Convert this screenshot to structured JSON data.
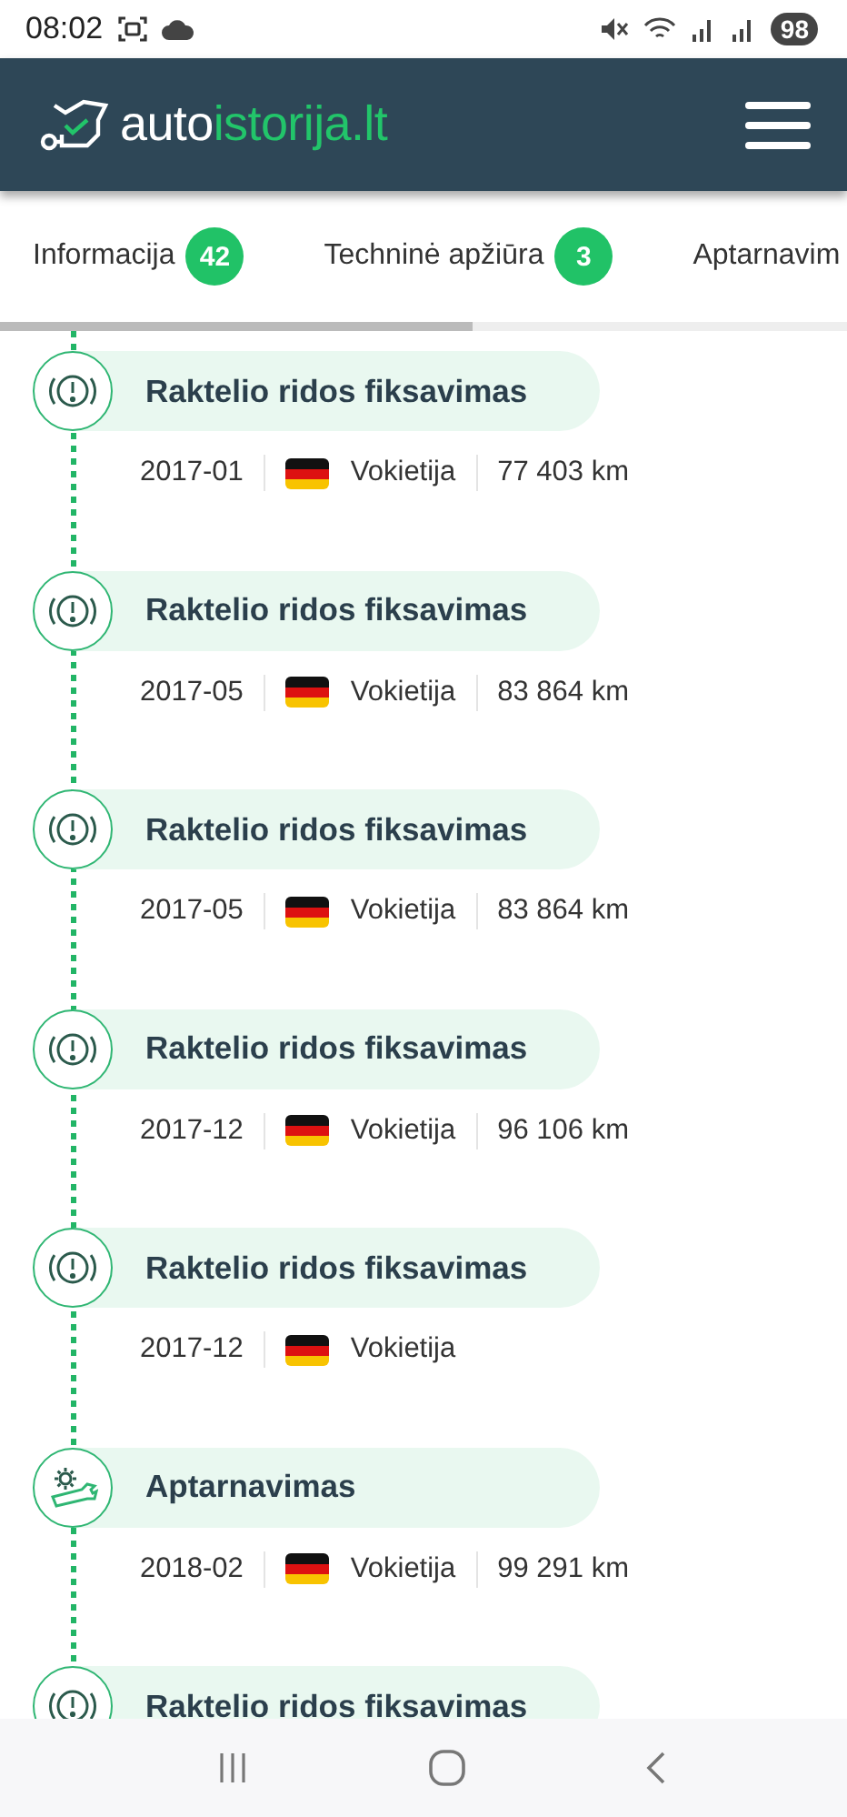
{
  "status_bar": {
    "time": "08:02",
    "battery": "98"
  },
  "header": {
    "logo": {
      "part_1": "auto",
      "part_2": "istorija.lt"
    }
  },
  "tabs": [
    {
      "label": "Informacija",
      "count": "42"
    },
    {
      "label": "Techninė apžiūra",
      "count": "3"
    },
    {
      "label": "Aptarnavim"
    }
  ],
  "events": [
    {
      "kind": "warning",
      "title": "Raktelio ridos fiksavimas",
      "date": "2017-01",
      "country": "Vokietija",
      "mileage": "77 403 km"
    },
    {
      "kind": "warning",
      "title": "Raktelio ridos fiksavimas",
      "date": "2017-05",
      "country": "Vokietija",
      "mileage": "83 864 km"
    },
    {
      "kind": "warning",
      "title": "Raktelio ridos fiksavimas",
      "date": "2017-05",
      "country": "Vokietija",
      "mileage": "83 864 km"
    },
    {
      "kind": "warning",
      "title": "Raktelio ridos fiksavimas",
      "date": "2017-12",
      "country": "Vokietija",
      "mileage": "96 106 km"
    },
    {
      "kind": "warning",
      "title": "Raktelio ridos fiksavimas",
      "date": "2017-12",
      "country": "Vokietija"
    },
    {
      "kind": "service",
      "title": "Aptarnavimas",
      "date": "2018-02",
      "country": "Vokietija",
      "mileage": "99 291 km"
    },
    {
      "kind": "warning",
      "title": "Raktelio ridos fiksavimas"
    }
  ]
}
